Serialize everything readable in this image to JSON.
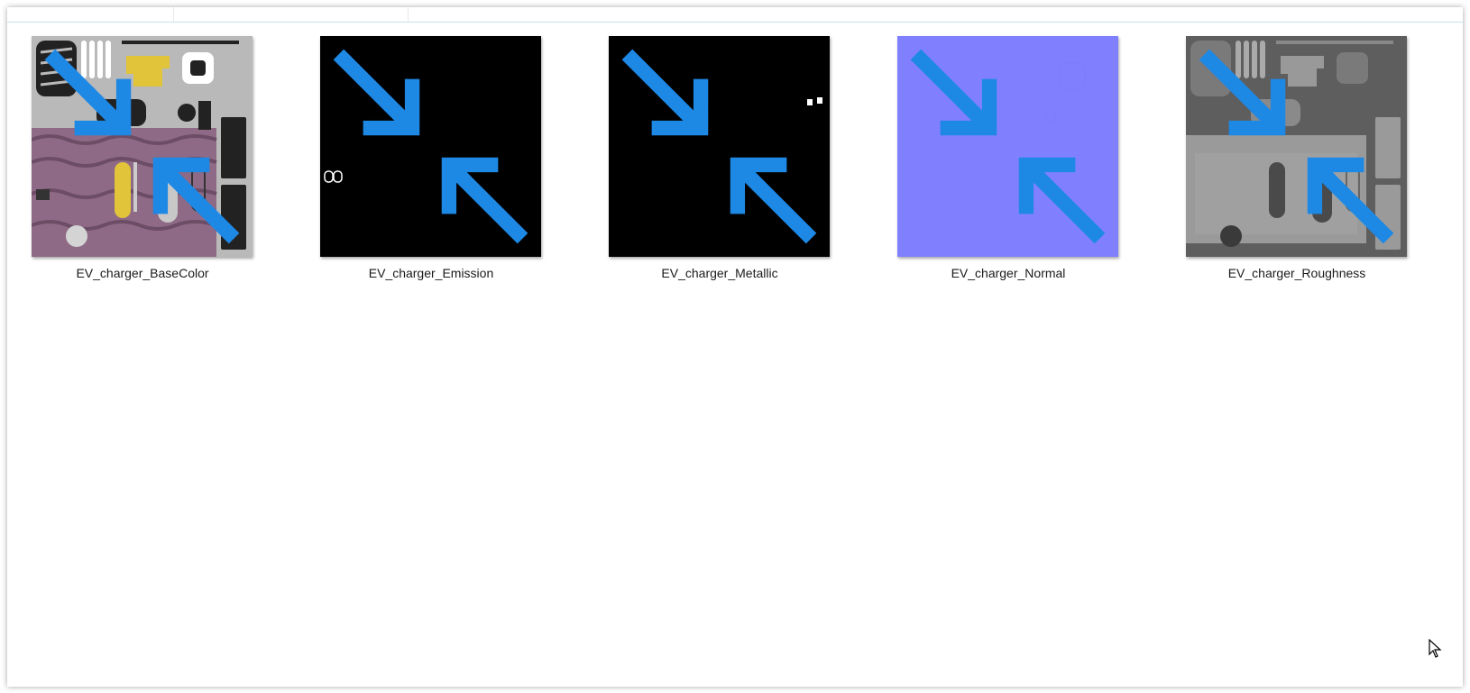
{
  "files": [
    {
      "name": "EV_charger_BaseColor"
    },
    {
      "name": "EV_charger_Emission"
    },
    {
      "name": "EV_charger_Metallic"
    },
    {
      "name": "EV_charger_Normal"
    },
    {
      "name": "EV_charger_Roughness"
    }
  ],
  "colors": {
    "badge": "#1e88e5",
    "normal_map": "#8080ff",
    "selection_line": "#c7e3ea"
  }
}
